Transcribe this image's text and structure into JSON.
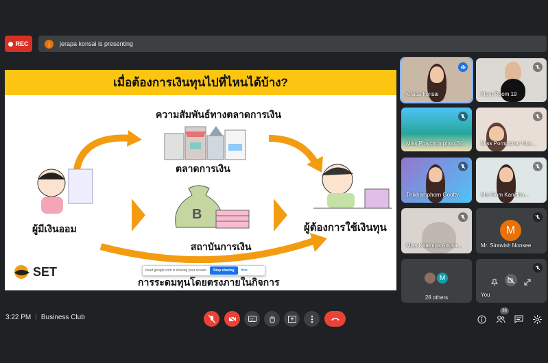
{
  "recording": {
    "label": "REC"
  },
  "presenter": {
    "initial": "j",
    "text": "jerapa konsai is presenting"
  },
  "slide": {
    "title": "เมื่อต้องการเงินทุนไปที่ไหนได้บ้าง?",
    "subtitle": "ความสัมพันธ์ทางตลาดการเงิน",
    "money_market": "ตลาดการเงิน",
    "savers": "ผู้มีเงินออม",
    "borrowers": "ผู้ต้องการใช้เงินทุน",
    "institutions": "สถาบันการเงิน",
    "direct": "การระดมทุนโดยตรงภายในกิจการ",
    "bag_letter": "B",
    "logo": "SET"
  },
  "share_banner": {
    "text": "meet.google.com is sharing your screen.",
    "stop": "Stop sharing",
    "hide": "Hide"
  },
  "participants": [
    {
      "name": "jerapa konsai",
      "muted": false
    },
    {
      "name": "Meet Room 19",
      "muted": true
    },
    {
      "name": "Miss Ploychomphoo S...",
      "muted": true
    },
    {
      "name": "Miss Pornpichar Hus...",
      "muted": true
    },
    {
      "name": "Thikhamphorn Goofty",
      "muted": true
    },
    {
      "name": "Mai Rom Kanittha...",
      "muted": true
    },
    {
      "name": "Miss Katenipa Anusa...",
      "muted": true
    },
    {
      "name": "Mr. Sirawish Nonsee",
      "initial": "M",
      "muted": true
    },
    {
      "name": "28 others",
      "initial": "M"
    },
    {
      "name": "You",
      "muted": true
    }
  ],
  "bottom": {
    "time": "3:22 PM",
    "meeting": "Business Club",
    "people_count": "38"
  },
  "colors": {
    "accent_red": "#ea4335",
    "banner": "#fbc511",
    "avatar_orange": "#e8710a"
  }
}
